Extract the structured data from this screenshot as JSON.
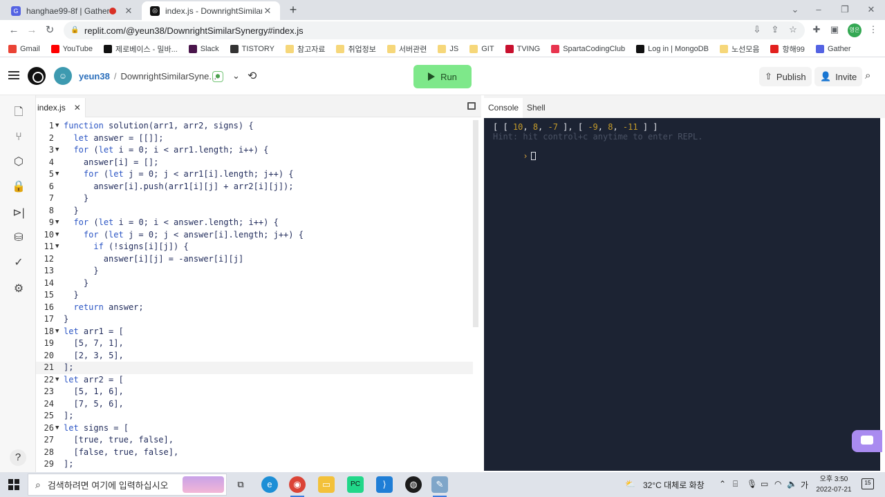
{
  "browser": {
    "tabs": [
      {
        "title": "hanghae99-8f | Gather",
        "favicon": "gather-icon",
        "active": false,
        "recording": true
      },
      {
        "title": "index.js - DownrightSimilarSyne",
        "favicon": "replit-icon",
        "active": true,
        "recording": false
      }
    ],
    "url": "replit.com/@yeun38/DownrightSimilarSynergy#index.js",
    "profile_badge": "영은",
    "bookmarks": [
      {
        "label": "Gmail",
        "icon": "gmail-icon",
        "color": "#ea4335"
      },
      {
        "label": "YouTube",
        "icon": "youtube-icon",
        "color": "#ff0000"
      },
      {
        "label": "제로베이스 - 밀바...",
        "icon": "zb-icon",
        "color": "#111111"
      },
      {
        "label": "Slack",
        "icon": "slack-icon",
        "color": "#4a154b"
      },
      {
        "label": "TISTORY",
        "icon": "tistory-icon",
        "color": "#333333"
      },
      {
        "label": "참고자료",
        "icon": "folder-icon",
        "color": "#f6d77a"
      },
      {
        "label": "취업정보",
        "icon": "folder-icon",
        "color": "#f6d77a"
      },
      {
        "label": "서버관련",
        "icon": "folder-icon",
        "color": "#f6d77a"
      },
      {
        "label": "JS",
        "icon": "folder-icon",
        "color": "#f6d77a"
      },
      {
        "label": "GIT",
        "icon": "folder-icon",
        "color": "#f6d77a"
      },
      {
        "label": "TVING",
        "icon": "tving-icon",
        "color": "#c8102e"
      },
      {
        "label": "SpartaCodingClub",
        "icon": "sparta-icon",
        "color": "#e8344e"
      },
      {
        "label": "Log in | MongoDB",
        "icon": "mongodb-icon",
        "color": "#111111"
      },
      {
        "label": "노선모음",
        "icon": "folder-icon",
        "color": "#f6d77a"
      },
      {
        "label": "항해99",
        "icon": "hanghae-icon",
        "color": "#e2201e"
      },
      {
        "label": "Gather",
        "icon": "gather-icon",
        "color": "#5463e3"
      }
    ]
  },
  "replit": {
    "username": "yeun38",
    "repl_name": "DownrightSimilarSyne...",
    "run_label": "Run",
    "publish_label": "Publish",
    "invite_label": "Invite",
    "file_tab": "index.js",
    "console_tabs": [
      "Console",
      "Shell"
    ],
    "help_label": "?"
  },
  "code": [
    {
      "n": "1",
      "fold": true,
      "text": "function solution(arr1, arr2, signs) {"
    },
    {
      "n": "2",
      "fold": false,
      "text": "  let answer = [[]];"
    },
    {
      "n": "3",
      "fold": true,
      "text": "  for (let i = 0; i < arr1.length; i++) {"
    },
    {
      "n": "4",
      "fold": false,
      "text": "    answer[i] = [];"
    },
    {
      "n": "5",
      "fold": true,
      "text": "    for (let j = 0; j < arr1[i].length; j++) {"
    },
    {
      "n": "6",
      "fold": false,
      "text": "      answer[i].push(arr1[i][j] + arr2[i][j]);"
    },
    {
      "n": "7",
      "fold": false,
      "text": "    }"
    },
    {
      "n": "8",
      "fold": false,
      "text": "  }"
    },
    {
      "n": "9",
      "fold": true,
      "text": "  for (let i = 0; i < answer.length; i++) {"
    },
    {
      "n": "10",
      "fold": true,
      "text": "    for (let j = 0; j < answer[i].length; j++) {"
    },
    {
      "n": "11",
      "fold": true,
      "text": "      if (!signs[i][j]) {"
    },
    {
      "n": "12",
      "fold": false,
      "text": "        answer[i][j] = -answer[i][j]"
    },
    {
      "n": "13",
      "fold": false,
      "text": "      }"
    },
    {
      "n": "14",
      "fold": false,
      "text": "    }"
    },
    {
      "n": "15",
      "fold": false,
      "text": "  }"
    },
    {
      "n": "16",
      "fold": false,
      "text": "  return answer;"
    },
    {
      "n": "17",
      "fold": false,
      "text": "}"
    },
    {
      "n": "18",
      "fold": true,
      "text": "let arr1 = ["
    },
    {
      "n": "19",
      "fold": false,
      "text": "  [5, 7, 1],"
    },
    {
      "n": "20",
      "fold": false,
      "text": "  [2, 3, 5],"
    },
    {
      "n": "21",
      "fold": false,
      "text": "];"
    },
    {
      "n": "22",
      "fold": true,
      "text": "let arr2 = ["
    },
    {
      "n": "23",
      "fold": false,
      "text": "  [5, 1, 6],"
    },
    {
      "n": "24",
      "fold": false,
      "text": "  [7, 5, 6],"
    },
    {
      "n": "25",
      "fold": false,
      "text": "];"
    },
    {
      "n": "26",
      "fold": true,
      "text": "let signs = ["
    },
    {
      "n": "27",
      "fold": false,
      "text": "  [true, true, false],"
    },
    {
      "n": "28",
      "fold": false,
      "text": "  [false, true, false],"
    },
    {
      "n": "29",
      "fold": false,
      "text": "];"
    }
  ],
  "current_line": "21",
  "console": {
    "output": "[ [ 10, 8, -7 ], [ -9, 8, -11 ] ]",
    "hint": "Hint: hit control+c anytime to enter REPL.",
    "prompt": "›"
  },
  "taskbar": {
    "search_placeholder": "검색하려면 여기에 입력하십시오",
    "weather": "32°C  대체로 화창",
    "ime": "가",
    "time": "오후 3:50",
    "date": "2022-07-21",
    "notifications": "15"
  },
  "colors": {
    "run_button": "#7ee88a",
    "console_bg": "#1c2333",
    "keyword": "#2b55c4",
    "number": "#c59c2a"
  }
}
